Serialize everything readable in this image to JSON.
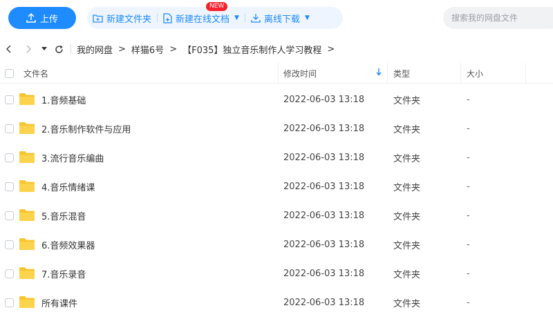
{
  "toolbar": {
    "upload_label": "上传",
    "new_folder_label": "新建文件夹",
    "new_online_doc_label": "新建在线文档",
    "new_badge": "NEW",
    "offline_download_label": "离线下载",
    "search_placeholder": "搜索我的网盘文件"
  },
  "breadcrumb": {
    "items": [
      "我的网盘",
      "样猫6号",
      "【F035】独立音乐制作人学习教程"
    ],
    "separator": ">"
  },
  "table": {
    "headers": {
      "name": "文件名",
      "modified": "修改时间",
      "type": "类型",
      "size": "大小"
    },
    "rows": [
      {
        "name": "1.音频基础",
        "modified": "2022-06-03 13:18",
        "type": "文件夹",
        "size": "-"
      },
      {
        "name": "2.音乐制作软件与应用",
        "modified": "2022-06-03 13:18",
        "type": "文件夹",
        "size": "-"
      },
      {
        "name": "3.流行音乐编曲",
        "modified": "2022-06-03 13:18",
        "type": "文件夹",
        "size": "-"
      },
      {
        "name": "4.音乐情绪课",
        "modified": "2022-06-03 13:18",
        "type": "文件夹",
        "size": "-"
      },
      {
        "name": "5.音乐混音",
        "modified": "2022-06-03 13:18",
        "type": "文件夹",
        "size": "-"
      },
      {
        "name": "6.音频效果器",
        "modified": "2022-06-03 13:18",
        "type": "文件夹",
        "size": "-"
      },
      {
        "name": "7.音乐录音",
        "modified": "2022-06-03 13:18",
        "type": "文件夹",
        "size": "-"
      },
      {
        "name": "所有课件",
        "modified": "2022-06-03 13:18",
        "type": "文件夹",
        "size": "-"
      }
    ]
  },
  "colors": {
    "accent": "#1e8bff",
    "folder": "#f8c42f",
    "badge": "#f5222d"
  }
}
